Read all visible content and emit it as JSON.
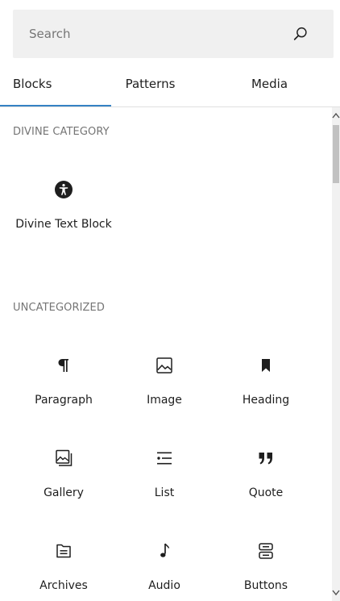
{
  "search": {
    "placeholder": "Search",
    "icon": "search-icon"
  },
  "tabs": [
    {
      "label": "Blocks",
      "active": true
    },
    {
      "label": "Patterns"
    },
    {
      "label": "Media"
    }
  ],
  "colors": {
    "accent": "#3582c4",
    "category": "#757575",
    "search_bg": "#f0f0f0"
  },
  "categories": [
    {
      "title": "Divine Category",
      "blocks": [
        {
          "label": "Divine Text Block",
          "icon": "universal-access-icon"
        }
      ]
    },
    {
      "title": "Uncategorized",
      "blocks": [
        {
          "label": "Paragraph",
          "icon": "paragraph-icon"
        },
        {
          "label": "Image",
          "icon": "image-icon"
        },
        {
          "label": "Heading",
          "icon": "bookmark-icon"
        },
        {
          "label": "Gallery",
          "icon": "gallery-icon"
        },
        {
          "label": "List",
          "icon": "list-icon"
        },
        {
          "label": "Quote",
          "icon": "quote-icon"
        },
        {
          "label": "Archives",
          "icon": "archive-icon"
        },
        {
          "label": "Audio",
          "icon": "music-note-icon"
        },
        {
          "label": "Buttons",
          "icon": "buttons-icon"
        }
      ]
    }
  ]
}
